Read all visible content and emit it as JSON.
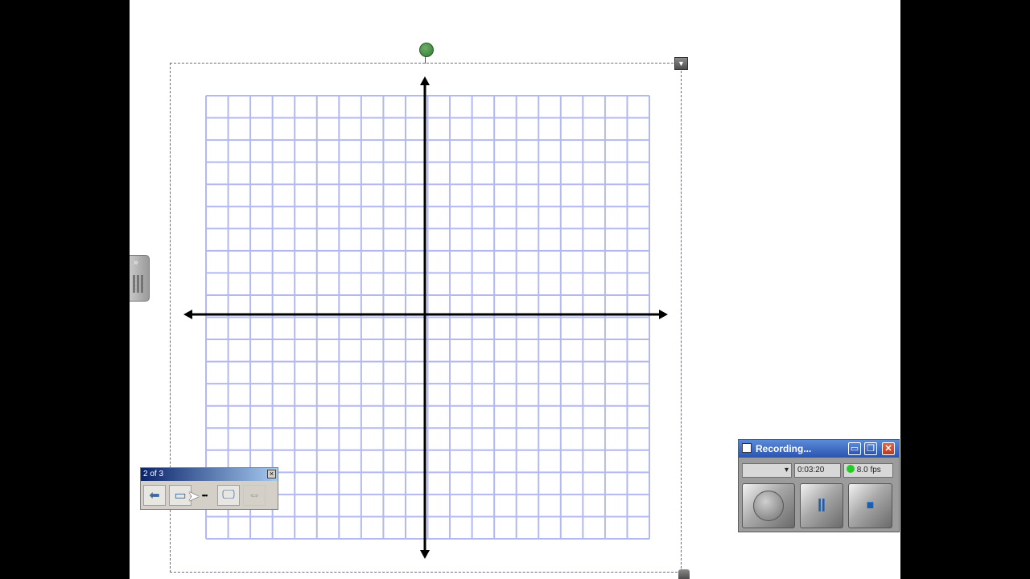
{
  "page_navigator": {
    "counter": "2 of 3",
    "close_label": "×",
    "buttons": [
      {
        "name": "previous-page-button",
        "icon": "arrow-left-icon",
        "glyph": "⬅"
      },
      {
        "name": "next-page-button",
        "icon": "page-next-icon",
        "glyph": "▭"
      },
      {
        "name": "more-button",
        "icon": "ellipsis-icon",
        "glyph": "•••"
      },
      {
        "name": "display-button",
        "icon": "monitor-icon",
        "glyph": "🖵"
      },
      {
        "name": "move-toolbar-button",
        "icon": "move-arrows-icon",
        "glyph": "⇔"
      }
    ]
  },
  "recorder": {
    "title": "Recording...",
    "elapsed_time": "0:03:20",
    "frame_rate": "8.0 fps",
    "status_color": "#22cc22",
    "window_buttons": {
      "minimize": "▭",
      "restore": "❐",
      "close": "✕"
    },
    "controls": [
      {
        "name": "record-button",
        "icon": "record-icon"
      },
      {
        "name": "pause-button",
        "icon": "pause-icon",
        "glyph": "‖"
      },
      {
        "name": "stop-button",
        "icon": "stop-icon",
        "glyph": "■"
      }
    ]
  },
  "object_menu_glyph": "▼",
  "side_tab_glyph": "»",
  "colors": {
    "grid_line": "#b4b8f0",
    "axis": "#000000",
    "selection": "#6a6a8a",
    "page": "#ffffff",
    "background": "#000000"
  }
}
